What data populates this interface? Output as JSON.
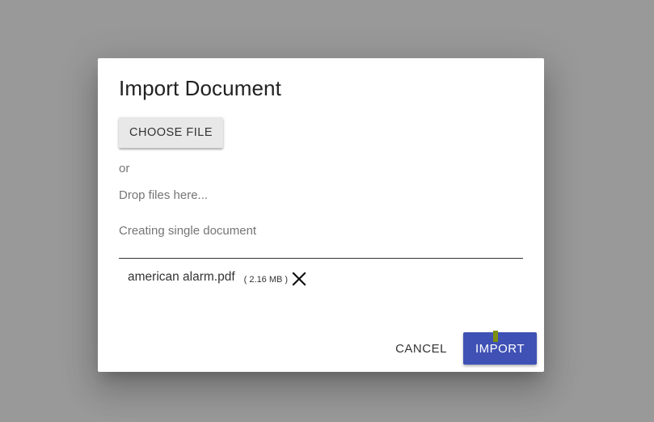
{
  "dialog": {
    "title": "Import Document",
    "choose_file_label": "CHOOSE FILE",
    "or_text": "or",
    "drop_hint": "Drop files here...",
    "mode_text": "Creating single document",
    "files": [
      {
        "name": "american alarm.pdf",
        "size": "( 2.16 MB )"
      }
    ],
    "cancel_label": "CANCEL",
    "import_label": "IMPORT"
  },
  "colors": {
    "backdrop": "#999999",
    "primary": "#3f51b5",
    "button_gray": "#e8e8e8"
  },
  "icons": {
    "remove": "close-icon"
  }
}
